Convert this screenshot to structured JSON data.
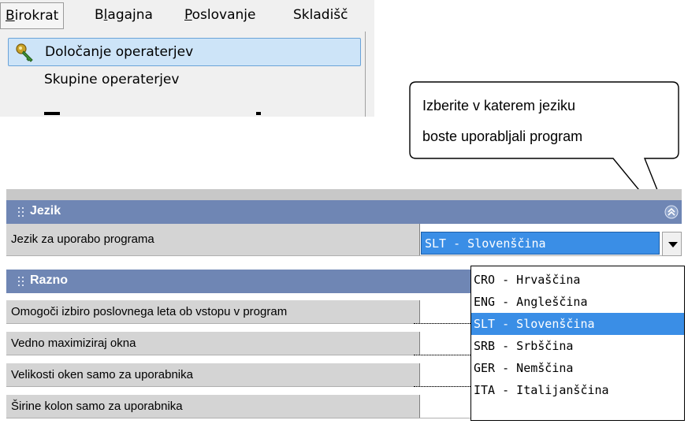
{
  "menubar": {
    "items": [
      {
        "label": "Birokrat",
        "mnemonic": "B",
        "rest": "irokrat",
        "active": true
      },
      {
        "label": "Blagajna",
        "pre": "B",
        "mnemonic": "l",
        "rest": "agajna"
      },
      {
        "label": "Poslovanje",
        "mnemonic": "P",
        "rest": "oslovanje"
      },
      {
        "label": "Skladišč",
        "pre": "Skladišč"
      }
    ]
  },
  "dropdown": {
    "items": [
      {
        "label": "Določanje operaterjev",
        "icon": "key-icon",
        "highlighted": true
      },
      {
        "label": "Skupine operaterjev"
      }
    ]
  },
  "callout": {
    "line1": "Izberite v katerem jeziku",
    "line2": "boste uporabljali program"
  },
  "sections": {
    "jezik": {
      "title": "Jezik"
    },
    "razno": {
      "title": "Razno"
    }
  },
  "rows": {
    "language_label": "Jezik za uporabo programa",
    "language_value": "SLT - Slovenščina",
    "razno": [
      "Omogoči izbiro poslovnega leta ob vstopu v program",
      "Vedno maximiziraj okna",
      "Velikosti oken samo za  uporabnika",
      "Širine kolon samo za uporabnika"
    ]
  },
  "language_options": [
    {
      "label": "CRO - Hrvaščina"
    },
    {
      "label": "ENG - Angleščina"
    },
    {
      "label": "SLT - Slovenščina",
      "selected": true
    },
    {
      "label": "SRB - Srbščina"
    },
    {
      "label": "GER - Nemščina"
    },
    {
      "label": "ITA - Italijanščina"
    }
  ],
  "colors": {
    "section_header": "#6f86b4",
    "selection": "#3a8ee6",
    "menu_highlight": "#cde4f8"
  }
}
